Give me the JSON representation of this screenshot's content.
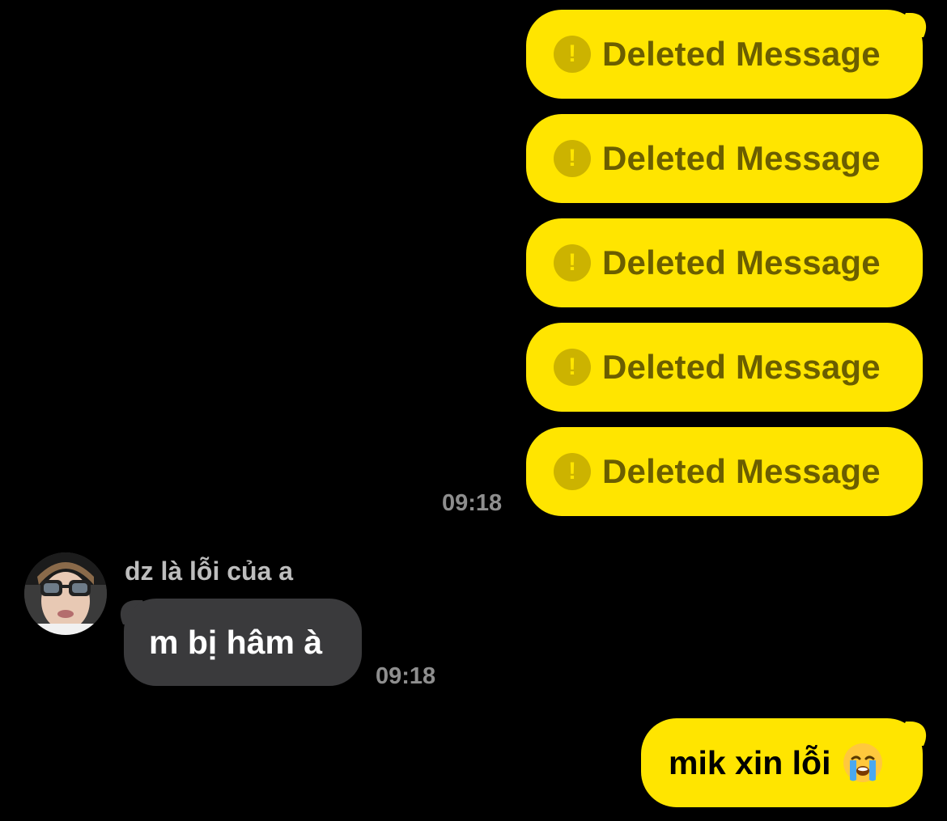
{
  "messages_outgoing_deleted": [
    {
      "text": "Deleted Message",
      "icon": "exclamation-circle-icon"
    },
    {
      "text": "Deleted Message",
      "icon": "exclamation-circle-icon"
    },
    {
      "text": "Deleted Message",
      "icon": "exclamation-circle-icon"
    },
    {
      "text": "Deleted Message",
      "icon": "exclamation-circle-icon"
    },
    {
      "text": "Deleted Message",
      "icon": "exclamation-circle-icon"
    }
  ],
  "deleted_group_time": "09:18",
  "incoming": {
    "sender_name": "dz là lỗi của a",
    "text": "m bị hâm à",
    "time": "09:18"
  },
  "outgoing_reply": {
    "text": "mik xin lỗi",
    "emoji": "loudly-crying-face-icon"
  },
  "colors": {
    "background": "#000000",
    "outgoing_bubble": "#FFE500",
    "incoming_bubble": "#3A3A3C",
    "deleted_text": "#6B5E00",
    "timestamp": "#8E8E8E"
  }
}
